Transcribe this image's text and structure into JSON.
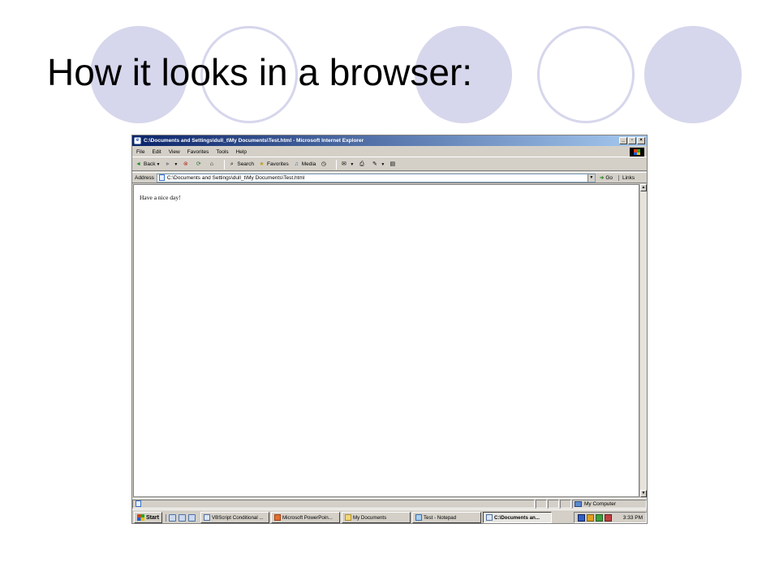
{
  "slide": {
    "title": "How it looks in a browser:",
    "accent_color": "#d6d6ec"
  },
  "browser": {
    "window_title": "C:\\Documents and Settings\\dull_t\\My Documents\\Test.html - Microsoft Internet Explorer",
    "window_buttons": {
      "minimize": "_",
      "maximize": "▫",
      "close": "×"
    },
    "menu": [
      "File",
      "Edit",
      "View",
      "Favorites",
      "Tools",
      "Help"
    ],
    "toolbar": {
      "back_label": "Back",
      "search_label": "Search",
      "favorites_label": "Favorites",
      "media_label": "Media"
    },
    "address": {
      "label": "Address",
      "value": "C:\\Documents and Settings\\dull_t\\My Documents\\Test.html",
      "go_label": "Go",
      "links_label": "Links"
    },
    "page_content": "Have a nice day!",
    "status": {
      "zone": "My Computer"
    }
  },
  "taskbar": {
    "start_label": "Start",
    "tasks": [
      {
        "label": "VBScript Conditional ...",
        "icon": "ie-icon",
        "active": false
      },
      {
        "label": "Microsoft PowerPoin...",
        "icon": "powerpoint-icon",
        "active": false
      },
      {
        "label": "My Documents",
        "icon": "folder-icon",
        "active": false
      },
      {
        "label": "Test - Notepad",
        "icon": "notepad-icon",
        "active": false
      },
      {
        "label": "C:\\Documents an...",
        "icon": "ie-icon",
        "active": true
      }
    ],
    "clock": "3:33 PM"
  }
}
